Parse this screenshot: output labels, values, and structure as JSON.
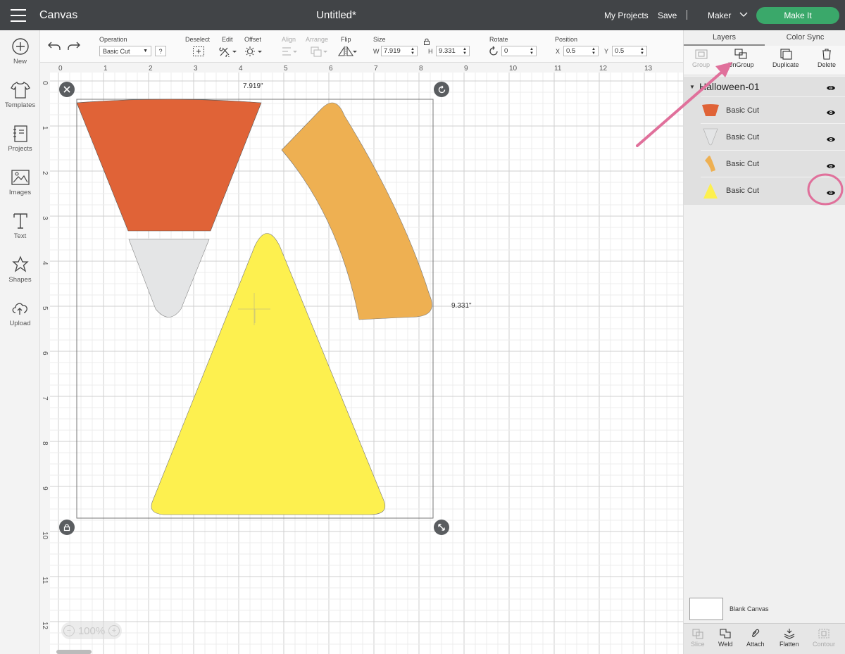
{
  "app": {
    "title": "Canvas",
    "document_title": "Untitled*"
  },
  "header": {
    "my_projects": "My Projects",
    "save": "Save",
    "separator": "|",
    "machine": "Maker",
    "make_it": "Make It"
  },
  "leftrail": {
    "items": [
      {
        "label": "New",
        "icon": "plus-circle-icon"
      },
      {
        "label": "Templates",
        "icon": "tshirt-icon"
      },
      {
        "label": "Projects",
        "icon": "notebook-icon"
      },
      {
        "label": "Images",
        "icon": "image-icon"
      },
      {
        "label": "Text",
        "icon": "text-icon"
      },
      {
        "label": "Shapes",
        "icon": "shapes-icon"
      },
      {
        "label": "Upload",
        "icon": "cloud-upload-icon"
      }
    ]
  },
  "toolbar": {
    "operation_label": "Operation",
    "operation_value": "Basic Cut",
    "help": "?",
    "deselect_label": "Deselect",
    "edit_label": "Edit",
    "offset_label": "Offset",
    "align_label": "Align",
    "arrange_label": "Arrange",
    "flip_label": "Flip",
    "size_label": "Size",
    "w_label": "W",
    "w_value": "7.919",
    "h_label": "H",
    "h_value": "9.331",
    "rotate_label": "Rotate",
    "rotate_value": "0",
    "position_label": "Position",
    "x_label": "X",
    "x_value": "0.5",
    "y_label": "Y",
    "y_value": "0.5"
  },
  "canvas": {
    "ruler_top": [
      "0",
      "1",
      "2",
      "3",
      "4",
      "5",
      "6",
      "7",
      "8",
      "9",
      "10",
      "11",
      "12",
      "13"
    ],
    "ruler_left": [
      "0",
      "1",
      "2",
      "3",
      "4",
      "5",
      "6",
      "7",
      "8",
      "9",
      "10",
      "11",
      "12"
    ],
    "width_readout": "7.919\"",
    "height_readout": "9.331\"",
    "zoom": "100%",
    "zoom_minus": "−",
    "zoom_plus": "+",
    "shape_colors": {
      "orange": "#e06337",
      "gray": "#e4e5e6",
      "light_orange": "#eeb052",
      "yellow": "#fdf04f"
    }
  },
  "panel": {
    "tabs": [
      "Layers",
      "Color Sync"
    ],
    "actions": [
      "Group",
      "UnGroup",
      "Duplicate",
      "Delete"
    ],
    "group_name": "Halloween-01",
    "layers": [
      {
        "name": "Basic Cut",
        "color": "#e06337",
        "shape": "trapezoid"
      },
      {
        "name": "Basic Cut",
        "color": "#e4e5e6",
        "shape": "cone"
      },
      {
        "name": "Basic Cut",
        "color": "#eeb052",
        "shape": "strip"
      },
      {
        "name": "Basic Cut",
        "color": "#fdf04f",
        "shape": "triangle"
      }
    ],
    "blank_canvas": "Blank Canvas",
    "bottom_actions": [
      "Slice",
      "Weld",
      "Attach",
      "Flatten",
      "Contour"
    ]
  },
  "annotation_color": "#e0709b"
}
